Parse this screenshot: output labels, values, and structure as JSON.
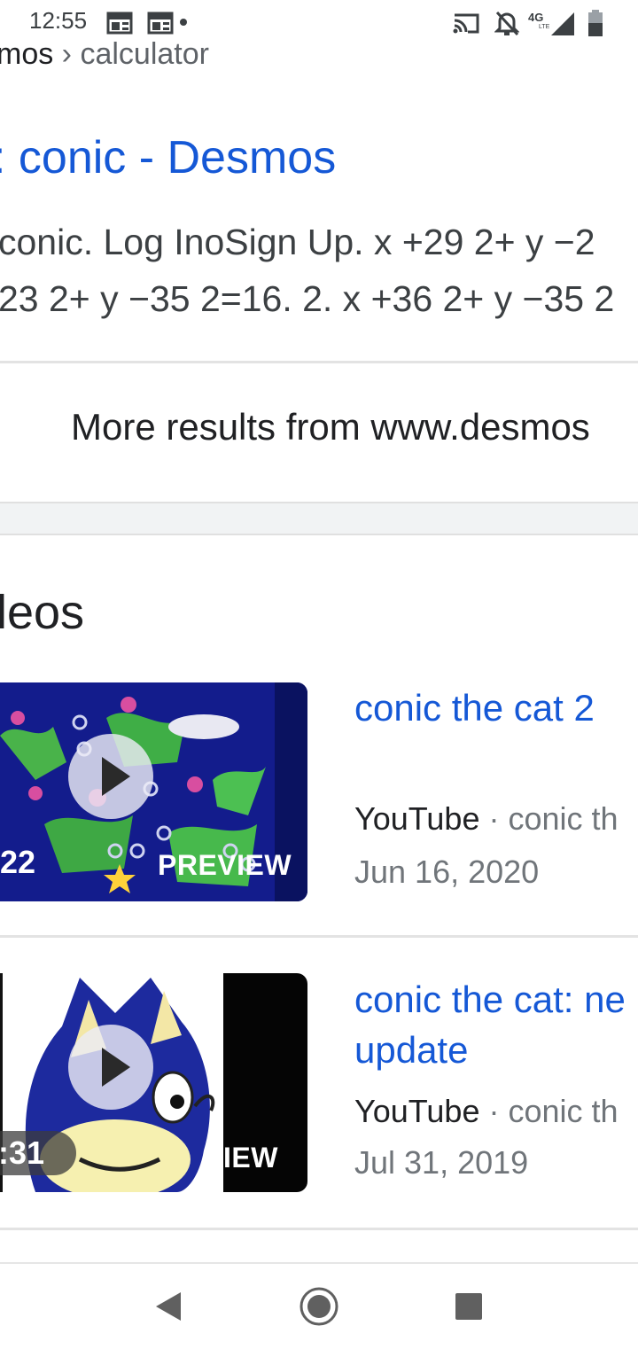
{
  "status_bar": {
    "time": "12:55",
    "left_icons": [
      "newspaper-icon",
      "newspaper-icon",
      "dot-icon"
    ],
    "right_icons": [
      "cast-icon",
      "bell-off-icon",
      "signal-4g-lte-icon",
      "battery-icon"
    ]
  },
  "result": {
    "breadcrumb_site": "mos",
    "breadcrumb_sep": " › ",
    "breadcrumb_path": "calculator",
    "title": ": conic - Desmos",
    "snippet_line1": "conic. Log InoSign Up. x +29 2+ y −2",
    "snippet_line2": "23 2+ y −35 2=16. 2. x +36 2+ y −35 2",
    "more_results": "More results from www.desmos"
  },
  "videos": {
    "heading": "leos",
    "items": [
      {
        "title_lines": [
          "conic the cat 2"
        ],
        "source": "YouTube",
        "separator": " · ",
        "channel": "conic th",
        "date": "Jun 16, 2020",
        "duration": "22",
        "preview_label": "PREVIEW"
      },
      {
        "title_lines": [
          "conic the cat: ne",
          "update"
        ],
        "source": "YouTube",
        "separator": " · ",
        "channel": "conic th",
        "date": "Jul 31, 2019",
        "duration": ":31",
        "preview_label": "IEW"
      }
    ]
  },
  "nav_bar": {
    "icons": [
      "back-icon",
      "home-icon",
      "recents-icon"
    ]
  },
  "colors": {
    "link": "#1558d6",
    "text": "#202124",
    "muted": "#70757a",
    "divider": "#e3e3e3"
  }
}
